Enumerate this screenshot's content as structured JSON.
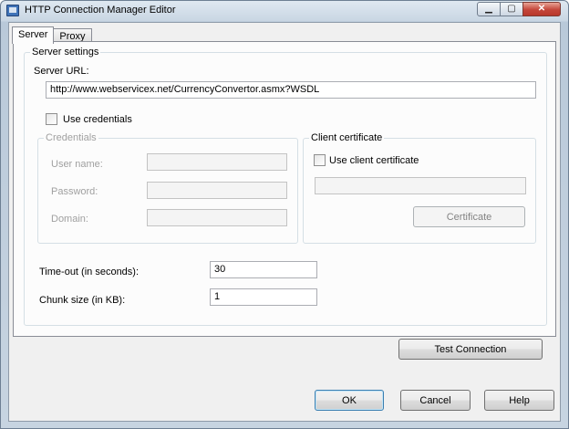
{
  "window": {
    "title": "HTTP Connection Manager Editor"
  },
  "caption_buttons": {
    "minimize": "▁",
    "maximize": "▢",
    "close": "✕"
  },
  "tabs": [
    {
      "label": "Server",
      "active": true
    },
    {
      "label": "Proxy",
      "active": false
    }
  ],
  "server_settings": {
    "legend": "Server settings",
    "server_url_label": "Server URL:",
    "server_url_value": "http://www.webservicex.net/CurrencyConvertor.asmx?WSDL",
    "use_credentials_label": "Use credentials",
    "use_credentials_checked": false,
    "credentials": {
      "legend": "Credentials",
      "user_name_label": "User name:",
      "user_name_value": "",
      "password_label": "Password:",
      "password_value": "",
      "domain_label": "Domain:",
      "domain_value": ""
    },
    "client_certificate": {
      "legend": "Client certificate",
      "use_client_certificate_label": "Use client certificate",
      "use_client_certificate_checked": false,
      "certificate_value": "",
      "certificate_button": "Certificate"
    },
    "timeout_label": "Time-out (in seconds):",
    "timeout_value": "30",
    "chunk_size_label": "Chunk size (in KB):",
    "chunk_size_value": "1"
  },
  "buttons": {
    "test_connection": "Test Connection",
    "ok": "OK",
    "cancel": "Cancel",
    "help": "Help"
  },
  "colors": {
    "window_frame": "#c7d4e1",
    "dialog_background": "#f0f0f0",
    "default_button_border": "#3c7fb1"
  }
}
